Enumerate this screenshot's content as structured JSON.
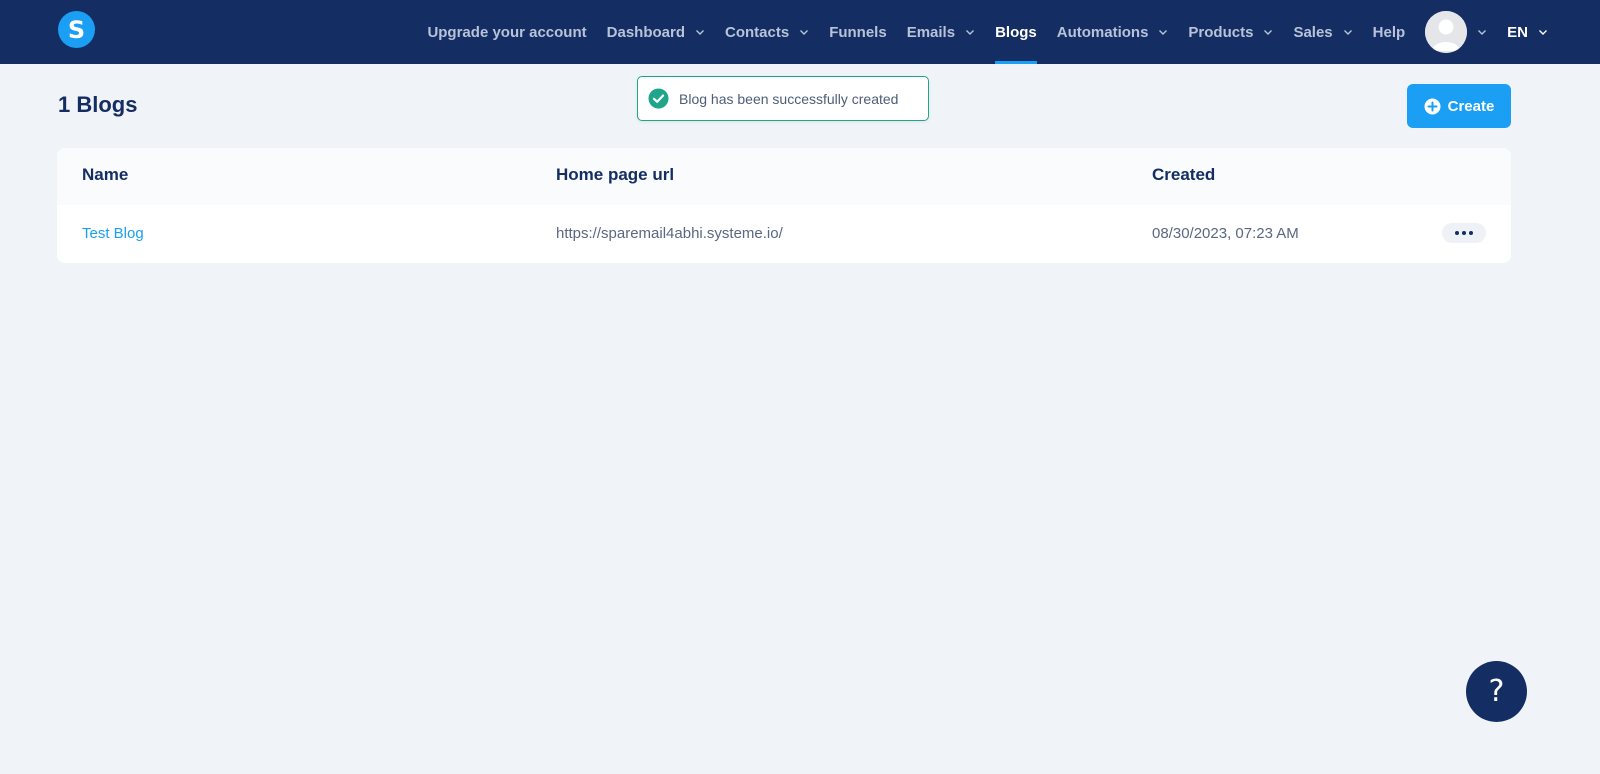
{
  "nav": {
    "logo_letter": "S",
    "items": [
      {
        "label": "Upgrade your account",
        "dropdown": false,
        "active": false
      },
      {
        "label": "Dashboard",
        "dropdown": true,
        "active": false
      },
      {
        "label": "Contacts",
        "dropdown": true,
        "active": false
      },
      {
        "label": "Funnels",
        "dropdown": false,
        "active": false
      },
      {
        "label": "Emails",
        "dropdown": true,
        "active": false
      },
      {
        "label": "Blogs",
        "dropdown": false,
        "active": true
      },
      {
        "label": "Automations",
        "dropdown": true,
        "active": false
      },
      {
        "label": "Products",
        "dropdown": true,
        "active": false
      },
      {
        "label": "Sales",
        "dropdown": true,
        "active": false
      },
      {
        "label": "Help",
        "dropdown": false,
        "active": false
      }
    ],
    "language": "EN"
  },
  "page": {
    "title": "1 Blogs",
    "create_label": "Create"
  },
  "toast": {
    "message": "Blog has been successfully created"
  },
  "table": {
    "columns": [
      "Name",
      "Home page url",
      "Created"
    ],
    "rows": [
      {
        "name": "Test Blog",
        "url": "https://sparemail4abhi.systeme.io/",
        "created": "08/30/2023, 07:23 AM"
      }
    ]
  },
  "help": {
    "label": "?"
  },
  "colors": {
    "navbar": "#142d63",
    "accent": "#1a9ff5",
    "success": "#1ea58a",
    "background": "#f0f4f9"
  }
}
